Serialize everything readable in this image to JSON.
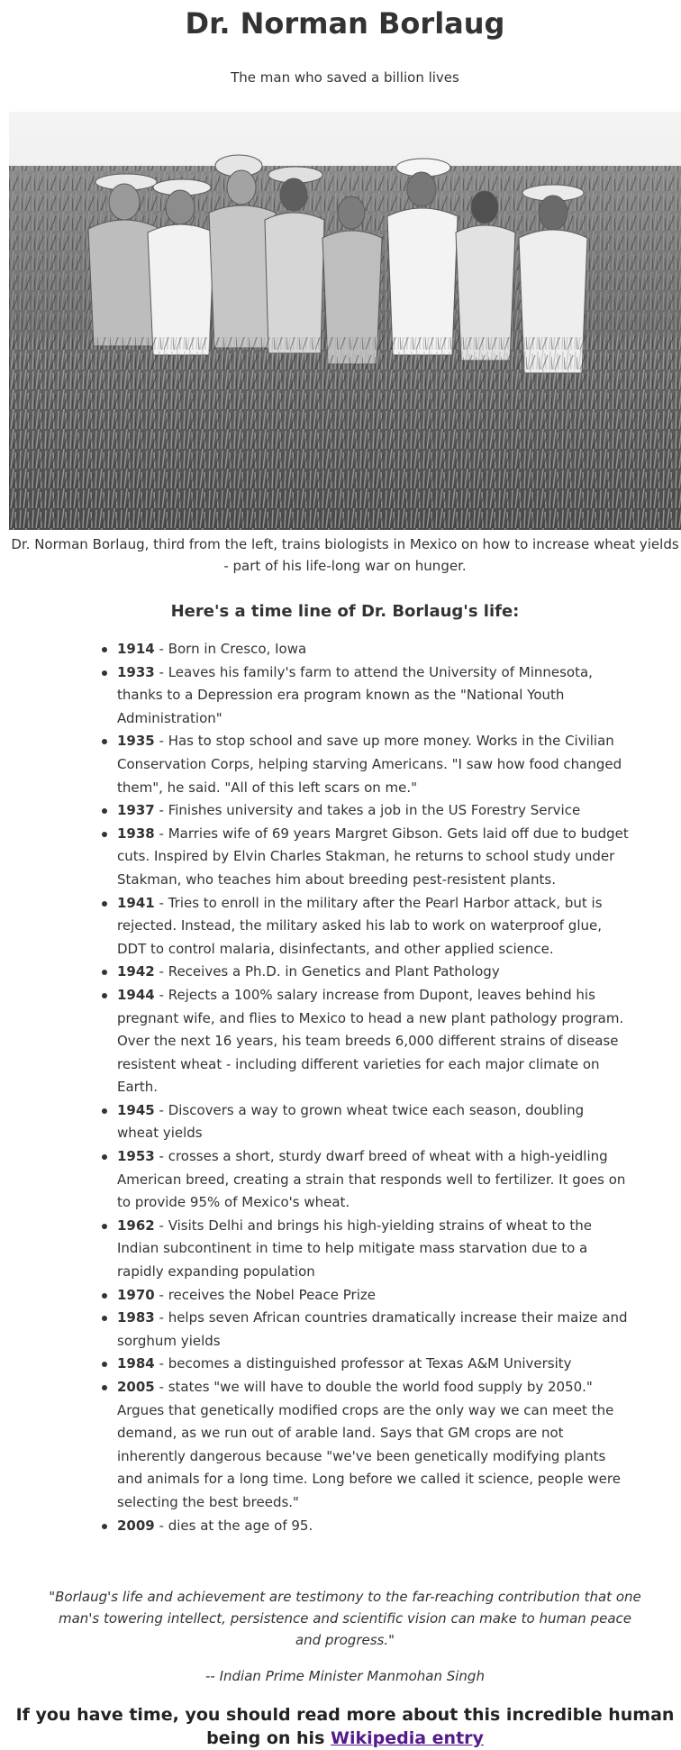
{
  "header": {
    "title": "Dr. Norman Borlaug",
    "subtitle": "The man who saved a billion lives"
  },
  "photo": {
    "alt": "Dr. Norman Borlaug with biologists in a wheat field in Mexico",
    "caption": "Dr. Norman Borlaug, third from the left, trains biologists in Mexico on how to increase wheat yields - part of his life-long war on hunger."
  },
  "timeline": {
    "heading": "Here's a time line of Dr. Borlaug's life:",
    "items": [
      {
        "year": "1914",
        "text": " - Born in Cresco, Iowa"
      },
      {
        "year": "1933",
        "text": " - Leaves his family's farm to attend the University of Minnesota, thanks to a Depression era program known as the \"National Youth Administration\""
      },
      {
        "year": "1935",
        "text": " - Has to stop school and save up more money. Works in the Civilian Conservation Corps, helping starving Americans. \"I saw how food changed them\", he said. \"All of this left scars on me.\""
      },
      {
        "year": "1937",
        "text": " - Finishes university and takes a job in the US Forestry Service"
      },
      {
        "year": "1938",
        "text": " - Marries wife of 69 years Margret Gibson. Gets laid off due to budget cuts. Inspired by Elvin Charles Stakman, he returns to school study under Stakman, who teaches him about breeding pest-resistent plants."
      },
      {
        "year": "1941",
        "text": " - Tries to enroll in the military after the Pearl Harbor attack, but is rejected. Instead, the military asked his lab to work on waterproof glue, DDT to control malaria, disinfectants, and other applied science."
      },
      {
        "year": "1942",
        "text": " - Receives a Ph.D. in Genetics and Plant Pathology"
      },
      {
        "year": "1944",
        "text": " - Rejects a 100% salary increase from Dupont, leaves behind his pregnant wife, and flies to Mexico to head a new plant pathology program. Over the next 16 years, his team breeds 6,000 different strains of disease resistent wheat - including different varieties for each major climate on Earth."
      },
      {
        "year": "1945",
        "text": " - Discovers a way to grown wheat twice each season, doubling wheat yields"
      },
      {
        "year": "1953",
        "text": " - crosses a short, sturdy dwarf breed of wheat with a high-yeidling American breed, creating a strain that responds well to fertilizer. It goes on to provide 95% of Mexico's wheat."
      },
      {
        "year": "1962",
        "text": " - Visits Delhi and brings his high-yielding strains of wheat to the Indian subcontinent in time to help mitigate mass starvation due to a rapidly expanding population"
      },
      {
        "year": "1970",
        "text": " - receives the Nobel Peace Prize"
      },
      {
        "year": "1983",
        "text": " - helps seven African countries dramatically increase their maize and sorghum yields"
      },
      {
        "year": "1984",
        "text": " - becomes a distinguished professor at Texas A&M University"
      },
      {
        "year": "2005",
        "text": " - states \"we will have to double the world food supply by 2050.\" Argues that genetically modified crops are the only way we can meet the demand, as we run out of arable land. Says that GM crops are not inherently dangerous because \"we've been genetically modifying plants and animals for a long time. Long before we called it science, people were selecting the best breeds.\""
      },
      {
        "year": "2009",
        "text": " - dies at the age of 95."
      }
    ]
  },
  "quote": {
    "text": "\"Borlaug's life and achievement are testimony to the far-reaching contribution that one man's towering intellect, persistence and scientific vision can make to human peace and progress.\"",
    "attribution": "-- Indian Prime Minister Manmohan Singh"
  },
  "more": {
    "text": "If you have time, you should read more about this incredible human being on his ",
    "link_label": "Wikipedia entry"
  },
  "colors": {
    "text": "#333333",
    "link": "#551a8b",
    "background": "#ffffff"
  }
}
